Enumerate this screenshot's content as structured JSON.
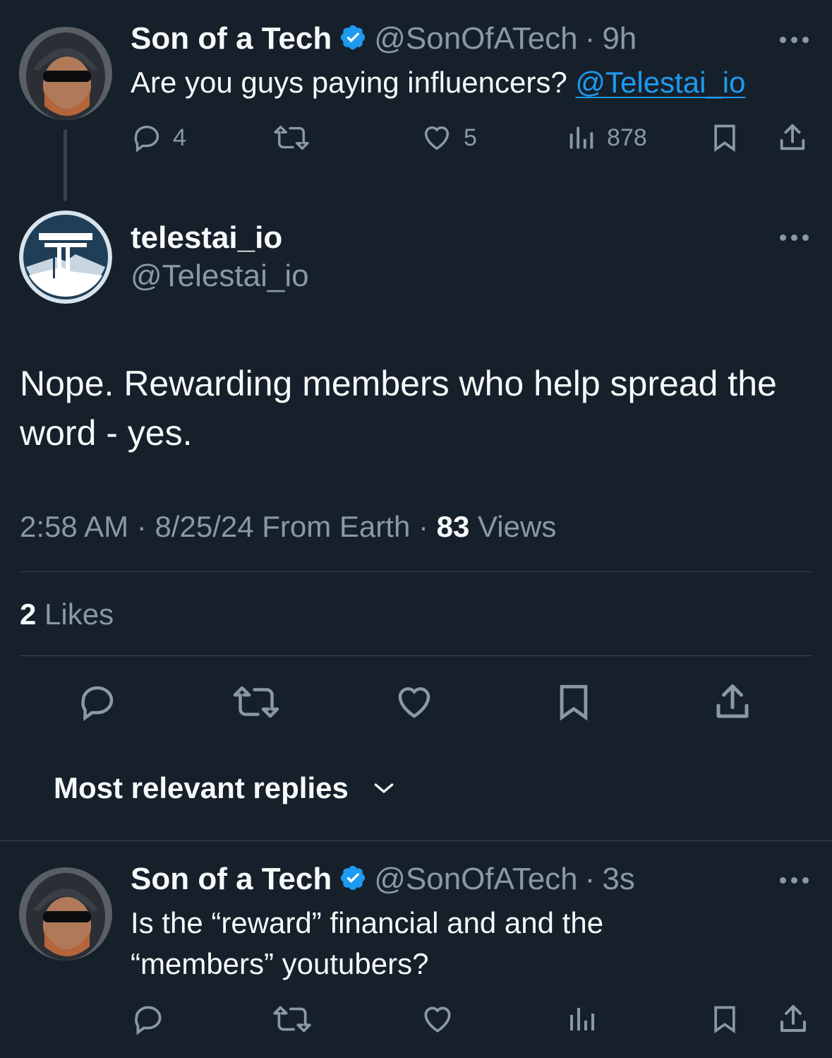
{
  "tweet1": {
    "author_name": "Son of a Tech",
    "handle": "@SonOfATech",
    "separator": "·",
    "time": "9h",
    "text_prefix": "Are you guys paying influencers? ",
    "mention": "@Telestai_io",
    "replies": "4",
    "likes": "5",
    "views": "878"
  },
  "main_tweet": {
    "author_name": "telestai_io",
    "handle": "@Telestai_io",
    "text_line1": "Nope. Rewarding members who help spread the",
    "text_line2": "word - yes.",
    "time": "2:58 AM",
    "date": "8/25/24",
    "source": "From Earth",
    "separator": "·",
    "views_count": "83",
    "views_label": "Views",
    "likes_count": "2",
    "likes_label": "Likes"
  },
  "replies_sort": {
    "label": "Most relevant replies"
  },
  "reply1": {
    "author_name": "Son of a Tech",
    "handle": "@SonOfATech",
    "separator": "·",
    "time": "3s",
    "text_line1": "Is the “reward” financial and and the",
    "text_line2": "“members” youtubers?"
  },
  "colors": {
    "background": "#15202b",
    "text": "#f7f9f9",
    "muted": "#8b98a5",
    "accent": "#1d9bf0",
    "divider": "#38444d"
  },
  "icons": [
    "reply-icon",
    "retweet-icon",
    "like-icon",
    "views-icon",
    "bookmark-icon",
    "share-icon",
    "more-icon",
    "verified-badge-icon",
    "chevron-down-icon"
  ]
}
